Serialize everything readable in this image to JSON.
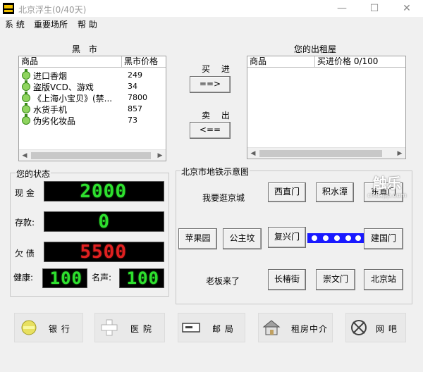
{
  "window": {
    "title": "北京浮生(0/40天)",
    "controls": {
      "minimize": "—",
      "maximize": "☐",
      "close": "✕"
    }
  },
  "menu": [
    "系 统",
    "重要场所",
    "帮 助"
  ],
  "market": {
    "title": "黑 市",
    "columns": [
      "商品",
      "黑市价格"
    ],
    "items": [
      {
        "name": "进口香烟",
        "price": "249",
        "icon": "goods-icon"
      },
      {
        "name": "盗版VCD、游戏",
        "price": "34",
        "icon": "goods-icon"
      },
      {
        "name": "《上海小宝贝》(禁...",
        "price": "7800",
        "icon": "goods-icon"
      },
      {
        "name": "水货手机",
        "price": "857",
        "icon": "goods-icon"
      },
      {
        "name": "伪劣化妆品",
        "price": "73",
        "icon": "goods-icon"
      }
    ]
  },
  "trade": {
    "buy_label": "买 进",
    "buy_button": "==>",
    "sell_label": "卖 出",
    "sell_button": "<=="
  },
  "rental": {
    "title": "您的出租屋",
    "columns": [
      "商品",
      "买进价格 0/100"
    ]
  },
  "status": {
    "title": "您的状态",
    "cash_label": "现 金",
    "cash_value": "2000",
    "deposit_label": "存款:",
    "deposit_value": "0",
    "debt_label": "欠 债",
    "debt_value": "5500",
    "health_label": "健康:",
    "health_value": "100",
    "fame_label": "名声:",
    "fame_value": "100"
  },
  "subway": {
    "title": "北京市地铁示意图",
    "tour_text": "我要逛京城",
    "boss_text": "老板来了",
    "stations": {
      "xizhimen": "西直门",
      "jishuitan": "积水潭",
      "dongzhimen": "东直门",
      "pingguoyuan": "苹果园",
      "gongzhufen": "公主坟",
      "fuxingmen": "复兴门",
      "jianguomen": "建国门",
      "changchunjie": "长椿街",
      "chongwenmen": "崇文门",
      "beijingzhan": "北京站"
    }
  },
  "places": [
    {
      "label": "银 行",
      "icon": "bank-icon"
    },
    {
      "label": "医 院",
      "icon": "hospital-icon"
    },
    {
      "label": "邮 局",
      "icon": "post-office-icon"
    },
    {
      "label": "租房中介",
      "icon": "rental-agency-icon"
    },
    {
      "label": "网 吧",
      "icon": "internet-cafe-icon"
    }
  ],
  "watermark": {
    "text": "触乐",
    "url_text": "chuapp.com"
  },
  "colors": {
    "lcd_green": "#2ee02e",
    "lcd_red": "#e02020",
    "subway_line": "#1a1aff"
  }
}
